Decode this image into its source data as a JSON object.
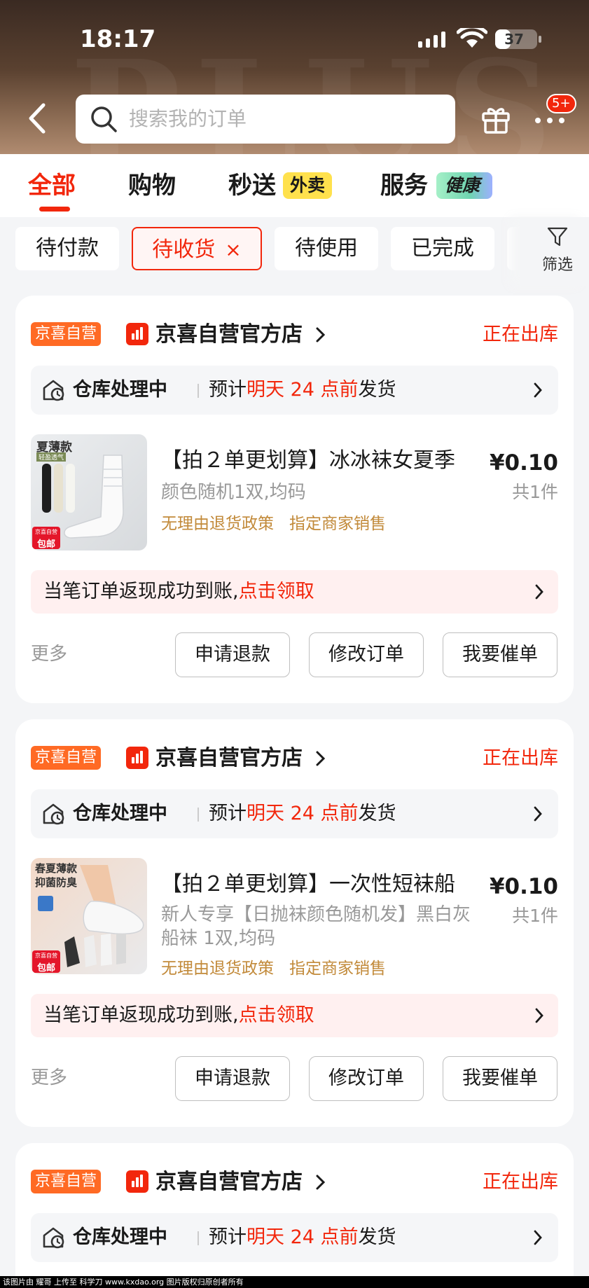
{
  "status_bar": {
    "time": "18:17",
    "battery": "37",
    "battery_level": 0.37
  },
  "header": {
    "search_placeholder": "搜索我的订单",
    "message_badge": "5+",
    "bg_text": "PLUS"
  },
  "tabs": [
    {
      "label": "全部",
      "active": true
    },
    {
      "label": "购物",
      "active": false
    },
    {
      "label": "秒送",
      "tag": "外卖",
      "active": false
    },
    {
      "label": "服务",
      "tag": "健康",
      "active": false
    }
  ],
  "filters": [
    {
      "label": "待付款",
      "selected": false
    },
    {
      "label": "待收货",
      "selected": true,
      "close": "×"
    },
    {
      "label": "待使用",
      "selected": false
    },
    {
      "label": "已完成",
      "selected": false
    }
  ],
  "filter_button": {
    "label": "筛选"
  },
  "orders": [
    {
      "badge": "京喜自营",
      "shop": "京喜自营官方店",
      "status": "正在出库",
      "ship_status": "仓库处理中",
      "ship_prefix": "预计",
      "ship_highlight": "明天 24 点前",
      "ship_suffix": "发货",
      "product": {
        "title": "【拍２单更划算】冰冰袜女夏季",
        "spec": "颜色随机1双,均码",
        "tags": [
          "无理由退货政策",
          "指定商家销售"
        ],
        "price": "¥0.10",
        "qty": "共1件",
        "img_top_label": "夏薄款",
        "img_sub_label": "轻盈透气",
        "img_badge_top": "京喜自营",
        "img_badge_bottom": "包邮"
      },
      "cash_text": "当笔订单返现成功到账,",
      "cash_link": "点击领取",
      "more": "更多",
      "actions": [
        "申请退款",
        "修改订单",
        "我要催单"
      ]
    },
    {
      "badge": "京喜自营",
      "shop": "京喜自营官方店",
      "status": "正在出库",
      "ship_status": "仓库处理中",
      "ship_prefix": "预计",
      "ship_highlight": "明天 24 点前",
      "ship_suffix": "发货",
      "product": {
        "title": "【拍２单更划算】一次性短袜船",
        "spec": "新人专享【日抛袜颜色随机发】黑白灰船袜 1双,均码",
        "tags": [
          "无理由退货政策",
          "指定商家销售"
        ],
        "price": "¥0.10",
        "qty": "共1件",
        "img_top_label": "春夏薄款",
        "img_sub_label": "抑菌防臭",
        "img_badge_top": "京喜自营",
        "img_badge_bottom": "包邮"
      },
      "cash_text": "当笔订单返现成功到账,",
      "cash_link": "点击领取",
      "more": "更多",
      "actions": [
        "申请退款",
        "修改订单",
        "我要催单"
      ]
    },
    {
      "badge": "京喜自营",
      "shop": "京喜自营官方店",
      "status": "正在出库",
      "ship_status": "仓库处理中",
      "ship_prefix": "预计",
      "ship_highlight": "明天 24 点前",
      "ship_suffix": "发货"
    }
  ],
  "watermark": "该图片由 耀哥 上传至 科学刀 www.kxdao.org 图片版权归原创者所有",
  "colors": {
    "accent": "#f2270c",
    "jd_tag": "#ff6a24",
    "tag_text": "#c28a3a"
  }
}
